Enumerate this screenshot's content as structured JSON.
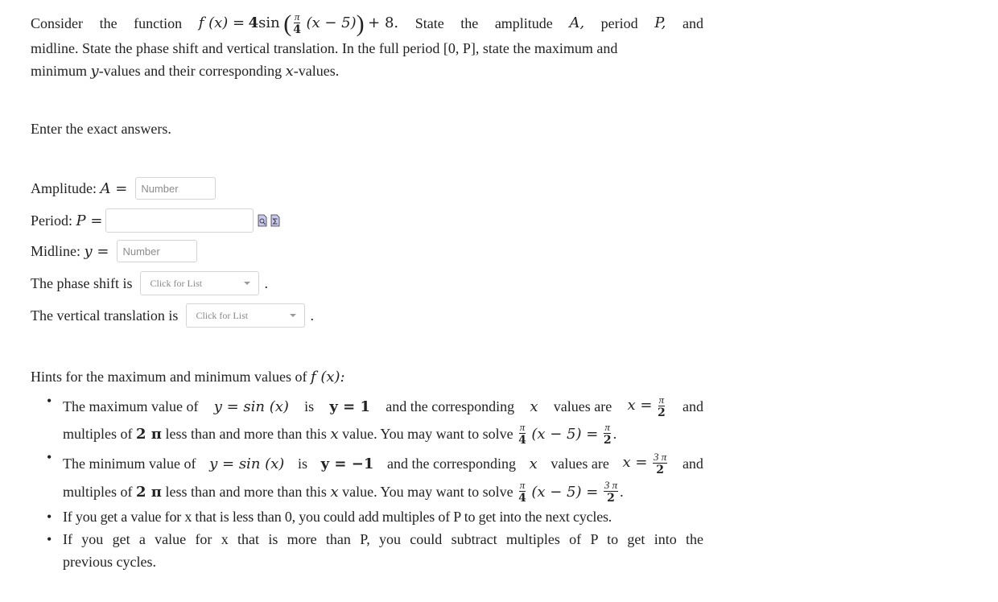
{
  "question": {
    "intro_words_line1": [
      "Consider",
      "the",
      "function"
    ],
    "function_expr": {
      "lhs": "f (x) =",
      "coef": "4",
      "func": "sin",
      "frac_num": "π",
      "frac_den": "4",
      "inner": "(x − 5)",
      "plus_const": "+ 8."
    },
    "line1_tail": [
      "State",
      "the",
      "amplitude",
      "A,",
      "period",
      "P,",
      "and"
    ],
    "line2": "midline. State the phase shift and vertical translation. In the full period [0, P], state the maximum and",
    "line3_a": "minimum ",
    "line3_y": "y",
    "line3_b": "-values and their corresponding ",
    "line3_x": "x",
    "line3_c": "-values."
  },
  "instructions": "Enter the exact answers.",
  "form": {
    "amplitude": {
      "label": "Amplitude:",
      "var": "A =",
      "placeholder": "Number",
      "value": ""
    },
    "period": {
      "label": "Period:",
      "var": "P =",
      "value": "",
      "icons": [
        "preview-icon",
        "equation-editor-icon"
      ]
    },
    "midline": {
      "label": "Midline:",
      "var": "y =",
      "placeholder": "Number",
      "value": ""
    },
    "phase_shift": {
      "label": "The phase shift is",
      "selected": "Click for List",
      "suffix": "."
    },
    "vertical_translation": {
      "label": "The vertical translation is",
      "selected": "Click for List",
      "suffix": "."
    }
  },
  "hints": {
    "title": "Hints for the maximum and minimum values of",
    "title_fx": "f (x):",
    "items": [
      {
        "l1_a": "The maximum value of",
        "l1_eq": "y = sin (x)",
        "l1_b": "is",
        "l1_val": "y = 1",
        "l1_c": "and the corresponding",
        "l1_x": "x",
        "l1_d": "values are",
        "l1_eq2": "x =",
        "l1_frac_num": "π",
        "l1_frac_den": "2",
        "l1_e": "and",
        "l2_a": "multiples of",
        "l2_mult": "2 π",
        "l2_b": "less than and more than this",
        "l2_x": "x",
        "l2_c": "value. You may want to solve",
        "l2_solve_inner": "(x − 5) =",
        "l2_rhs_num": "π",
        "l2_rhs_den": "2",
        "l2_end": "."
      },
      {
        "l1_a": "The minimum value of",
        "l1_eq": "y = sin (x)",
        "l1_b": "is",
        "l1_val": "y = −1",
        "l1_c": "and the corresponding",
        "l1_x": "x",
        "l1_d": "values are",
        "l1_eq2": "x =",
        "l1_frac_num": "3 π",
        "l1_frac_den": "2",
        "l1_e": "and",
        "l2_a": "multiples of",
        "l2_mult": "2 π",
        "l2_b": "less than and more than this",
        "l2_x": "x",
        "l2_c": "value. You may want to solve",
        "l2_solve_inner": "(x − 5) =",
        "l2_rhs_num": "3 π",
        "l2_rhs_den": "2",
        "l2_end": "."
      },
      {
        "text": "If you get a value for x that is less than 0, you could add multiples of P to get into the next cycles."
      },
      {
        "text_l1": "If you get a value for x that is more than P, you could subtract multiples of P to get into the",
        "text_l2": "previous cycles."
      }
    ]
  }
}
